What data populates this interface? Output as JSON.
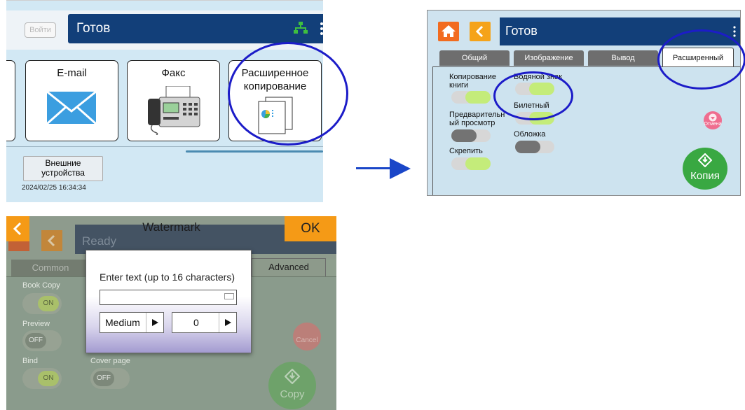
{
  "panel1": {
    "login_label": "Войти",
    "title": "Готов",
    "tiles": [
      {
        "label": "E-mail"
      },
      {
        "label": "Факс"
      },
      {
        "label": "Расширенное копирование"
      }
    ],
    "external_devices_label": "Внешние устройства",
    "timestamp": "2024/02/25 16:34:34"
  },
  "panel2": {
    "title": "Готов",
    "tabs": [
      {
        "label": "Общий",
        "active": false
      },
      {
        "label": "Изображение",
        "active": false
      },
      {
        "label": "Вывод",
        "active": false
      },
      {
        "label": "Расширенный",
        "active": true
      }
    ],
    "settings": {
      "book_copy": "Копирование книги",
      "preview": "Предварительный просмотр",
      "bind": "Скрепить",
      "watermark": "Водяной знак",
      "ticket": "Билетный",
      "cover": "Обложка"
    },
    "cancel_label": "Отмена",
    "copy_label": "Копия"
  },
  "panel3": {
    "header_title": "Watermark",
    "ok_label": "OK",
    "bg_title": "Ready",
    "tabs": {
      "common": "Common",
      "advanced": "Advanced"
    },
    "settings": {
      "book_copy": "Book Copy",
      "book_copy_state": "ON",
      "preview": "Preview",
      "preview_state": "OFF",
      "bind": "Bind",
      "bind_state": "ON",
      "cover": "Cover page",
      "cover_state": "OFF"
    },
    "cancel_label": "Cancel",
    "copy_label": "Copy",
    "dialog": {
      "prompt": "Enter text (up to 16 characters)",
      "text_value": "",
      "size_value": "Medium",
      "number_value": "0"
    }
  },
  "colors": {
    "header_blue": "#123f79",
    "highlight_circle": "#1c1cc8",
    "accent_orange": "#f59a16",
    "toggle_on": "#c4ec7a",
    "copy_green": "#39a842",
    "cancel_pink": "#ef6d8f"
  }
}
